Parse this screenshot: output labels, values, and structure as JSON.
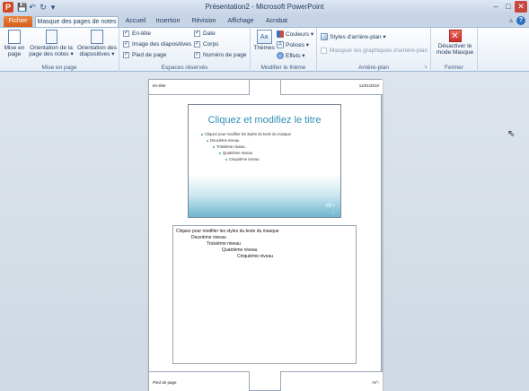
{
  "window": {
    "title": "Présentation2 - Microsoft PowerPoint",
    "app_icon_letter": "P",
    "controls": {
      "minimize": "–",
      "maximize": "□",
      "close": "✕"
    }
  },
  "quick_access": {
    "save": "💾",
    "undo": "↶",
    "redo": "↻",
    "customize": "▾"
  },
  "tabs": {
    "file": "Fichier",
    "notes_master": "Masque des pages de notes",
    "home": "Accueil",
    "insert": "Insertion",
    "review": "Révision",
    "view": "Affichage",
    "acrobat": "Acrobat"
  },
  "ribbon": {
    "page_setup": {
      "label": "Mise en page",
      "page_setup_btn": "Mise en page",
      "notes_orientation_btn": "Orientation de la page des notes ▾",
      "slide_orientation_btn": "Orientation des diapositives ▾"
    },
    "placeholders": {
      "label": "Espaces réservés",
      "header": "En-tête",
      "slide_image": "Image des diapositives",
      "footer": "Pied de page",
      "date": "Date",
      "body": "Corps",
      "page_number": "Numéro de page"
    },
    "theme": {
      "label": "Modifier le thème",
      "themes_btn": "Thèmes",
      "colors": "Couleurs ▾",
      "fonts": "Polices ▾",
      "effects": "Effets ▾"
    },
    "background": {
      "label": "Arrière-plan",
      "styles": "Styles d'arrière-plan ▾",
      "hide_graphics": "Masquer les graphiques d'arrière-plan"
    },
    "close": {
      "label": "Fermer",
      "close_btn": "Désactiver le mode Masque"
    }
  },
  "notes_page": {
    "header": "En-tête",
    "date": "11/01/2010",
    "footer": "Pied de page",
    "page_number": "‹N°›",
    "slide": {
      "title": "Cliquez et modifiez le titre",
      "levels": [
        "Cliquez pour modifier les styles du texte du masque",
        "Deuxième niveau",
        "Troisième niveau",
        "Quatrième niveau",
        "Cinquième niveau"
      ],
      "number": "‹N°›",
      "footer_small": "1"
    },
    "body_levels": [
      "Cliquez pour modifier les styles du texte du masque",
      "Deuxième niveau",
      "Troisième niveau",
      "Quatrième niveau",
      "Cinquième niveau"
    ]
  },
  "colors": {
    "file_tab": "#d85e1a",
    "slide_accent": "#2f8fb2",
    "close_master": "#d9342b"
  }
}
